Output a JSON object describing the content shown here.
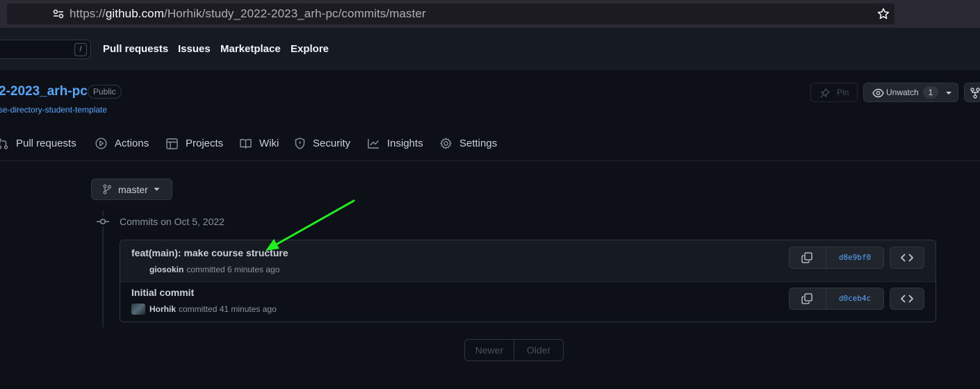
{
  "browser": {
    "url_prefix": "https://",
    "url_domain": "github.com",
    "url_path": "/Horhik/study_2022-2023_arh-pc/commits/master"
  },
  "header": {
    "search_shortcut": "/",
    "links": [
      "Pull requests",
      "Issues",
      "Marketplace",
      "Explore"
    ]
  },
  "repo": {
    "name": "2-2023_arh-pc",
    "visibility": "Public",
    "template_link": "se-directory-student-template",
    "pin_label": "Pin",
    "unwatch_label": "Unwatch",
    "watch_count": "1"
  },
  "repo_nav": [
    {
      "label": "Pull requests",
      "icon": "pull-request-icon"
    },
    {
      "label": "Actions",
      "icon": "play-icon"
    },
    {
      "label": "Projects",
      "icon": "table-icon"
    },
    {
      "label": "Wiki",
      "icon": "book-icon"
    },
    {
      "label": "Security",
      "icon": "shield-icon"
    },
    {
      "label": "Insights",
      "icon": "graph-icon"
    },
    {
      "label": "Settings",
      "icon": "gear-icon"
    }
  ],
  "branch": {
    "label": "master"
  },
  "commits": {
    "date_heading": "Commits on Oct 5, 2022",
    "items": [
      {
        "title": "feat(main): make course structure",
        "author": "giosokin",
        "meta": "committed 6 minutes ago",
        "sha": "d8e9bf0"
      },
      {
        "title": "Initial commit",
        "author": "Horhik",
        "meta": "committed 41 minutes ago",
        "sha": "d0ceb4c"
      }
    ]
  },
  "pagination": {
    "newer": "Newer",
    "older": "Older"
  },
  "colors": {
    "accent": "#58a6ff",
    "annotation_arrow": "#22ee22",
    "background": "#0d1117"
  }
}
